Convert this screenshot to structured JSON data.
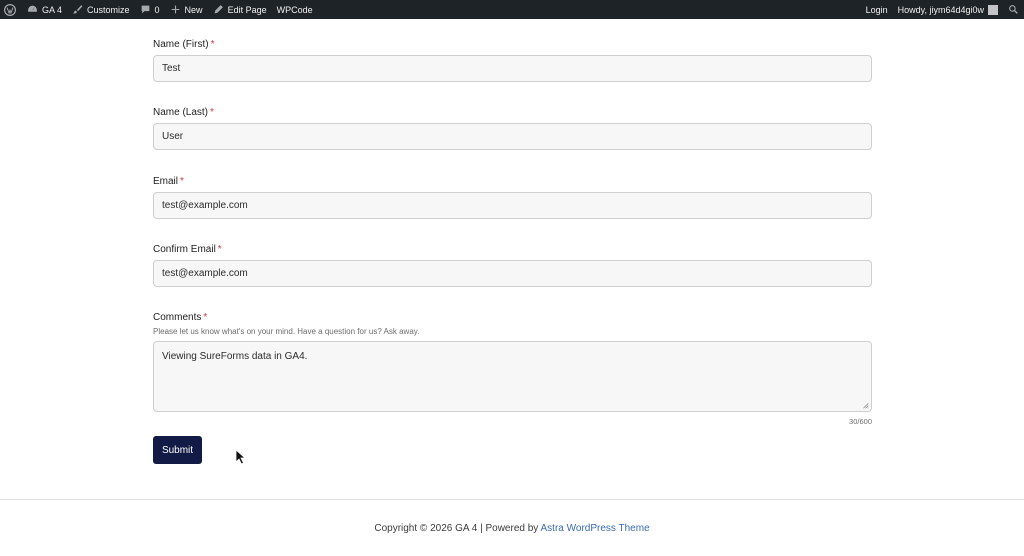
{
  "adminbar": {
    "site_name": "GA 4",
    "customize": "Customize",
    "comments_count": "0",
    "new_label": "New",
    "edit_page": "Edit Page",
    "wpcode": "WPCode",
    "login": "Login",
    "howdy": "Howdy, jiym64d4gi0w"
  },
  "form": {
    "first_name": {
      "label": "Name (First)",
      "required": "*",
      "value": "Test"
    },
    "last_name": {
      "label": "Name (Last)",
      "required": "*",
      "value": "User"
    },
    "email": {
      "label": "Email",
      "required": "*",
      "value": "test@example.com"
    },
    "confirm_email": {
      "label": "Confirm Email",
      "required": "*",
      "value": "test@example.com"
    },
    "comments": {
      "label": "Comments",
      "required": "*",
      "help": "Please let us know what's on your mind. Have a question for us? Ask away.",
      "value": "Viewing SureForms data in GA4.",
      "counter": "30/600"
    },
    "submit_label": "Submit"
  },
  "footer": {
    "text": "Copyright © 2026 GA 4 | Powered by ",
    "link": "Astra WordPress Theme"
  },
  "colors": {
    "adminbar_bg": "#1d2327",
    "submit_bg": "#121a46",
    "required": "#d63638",
    "link": "#3a6bb0"
  }
}
